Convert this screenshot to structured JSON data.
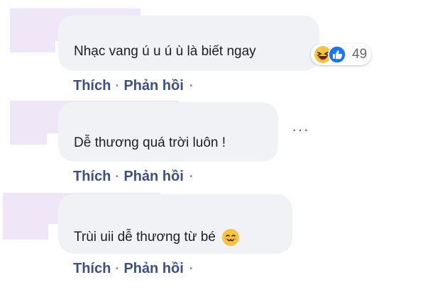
{
  "comments": [
    {
      "text": "Nhạc vang ú u ú ù là biết ngay",
      "reactions": {
        "icons": [
          "haha-icon",
          "like-icon"
        ],
        "count": "49"
      },
      "actions": {
        "like": "Thích",
        "reply": "Phản hồi",
        "separator": "·"
      }
    },
    {
      "text": "Dễ thương quá trời luôn !",
      "more_label": "···",
      "actions": {
        "like": "Thích",
        "reply": "Phản hồi",
        "separator": "·"
      }
    },
    {
      "text": "Trùi uii dễ thương từ bé",
      "emoji": "smiling-emoji",
      "actions": {
        "like": "Thích",
        "reply": "Phản hồi",
        "separator": "·"
      }
    }
  ],
  "colors": {
    "bubble": "#f0f2f5",
    "action_text": "#3b5185",
    "like_blue": "#1877f2",
    "haha_yellow": "#f7c43e",
    "avatar_mask": "#efe6f7"
  }
}
